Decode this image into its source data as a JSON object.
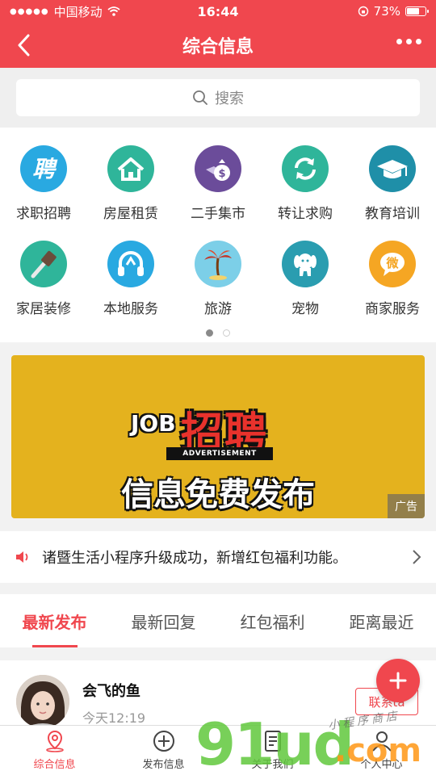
{
  "status_bar": {
    "carrier": "中国移动",
    "time": "16:44",
    "battery": "73%",
    "battery_level": 0.73
  },
  "header": {
    "title": "综合信息"
  },
  "search": {
    "placeholder": "搜索"
  },
  "categories": [
    {
      "label": "求职招聘",
      "icon": "recruit-icon",
      "color": "#29a9e1"
    },
    {
      "label": "房屋租赁",
      "icon": "house-icon",
      "color": "#2fb59a"
    },
    {
      "label": "二手集市",
      "icon": "money-bag-icon",
      "color": "#6b4c9a"
    },
    {
      "label": "转让求购",
      "icon": "refresh-icon",
      "color": "#2fb59a"
    },
    {
      "label": "教育培训",
      "icon": "graduation-cap-icon",
      "color": "#1f8fa8"
    },
    {
      "label": "家居装修",
      "icon": "brush-icon",
      "color": "#2fb59a"
    },
    {
      "label": "本地服务",
      "icon": "headset-icon",
      "color": "#29a9e1"
    },
    {
      "label": "旅游",
      "icon": "palm-tree-icon",
      "color": "#7ccfe8"
    },
    {
      "label": "宠物",
      "icon": "dog-icon",
      "color": "#2a9db0"
    },
    {
      "label": "商家服务",
      "icon": "wechat-shop-icon",
      "color": "#f5a623"
    }
  ],
  "banner": {
    "job_text": "JOB",
    "main_text": "招聘",
    "sub_label": "ADVERTISEMENT",
    "caption": "信息免费发布",
    "ad_label": "广告",
    "background": "#e4b21e"
  },
  "notice": {
    "text": "诸暨生活小程序升级成功，新增红包福利功能。"
  },
  "tabs": [
    {
      "label": "最新发布",
      "active": true
    },
    {
      "label": "最新回复",
      "active": false
    },
    {
      "label": "红包福利",
      "active": false
    },
    {
      "label": "距离最近",
      "active": false
    }
  ],
  "post": {
    "name": "会飞的鱼",
    "time": "今天12:19",
    "contact_label": "联系ta"
  },
  "bottom_nav": [
    {
      "label": "综合信息",
      "icon": "location-pin-icon",
      "active": true
    },
    {
      "label": "发布信息",
      "icon": "plus-circle-icon",
      "active": false
    },
    {
      "label": "关于我们",
      "icon": "document-icon",
      "active": false
    },
    {
      "label": "个人中心",
      "icon": "user-icon",
      "active": false
    }
  ],
  "watermark": {
    "brand": "91ud",
    "domain": ".com",
    "tagline": "小程序商店"
  },
  "colors": {
    "accent": "#f0474e",
    "background": "#f2f2f2"
  }
}
